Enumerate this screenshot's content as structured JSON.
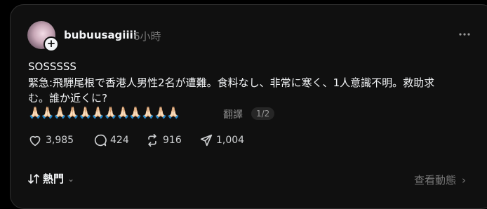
{
  "post": {
    "username": "bubuusagiiii",
    "time": "6小時",
    "lines": [
      "SOSSSSS",
      "緊急:飛騨尾根で香港人男性2名が遭難。食料なし、非常に寒く、1人意識不明。救助求",
      "む。誰か近くに?"
    ],
    "emoji_row": "🙏🏻🙏🏻🙏🏻🙏🏻🙏🏻🙏🏻🙏🏻🙏🏻🙏🏻🙏🏻🙏🏻🙏🏻",
    "translate_label": "翻譯",
    "pager": "1/2"
  },
  "actions": {
    "likes": "3,985",
    "replies": "424",
    "reposts": "916",
    "shares": "1,004"
  },
  "footer": {
    "sort_label": "熱門",
    "view_activity": "查看動態"
  },
  "icons": {
    "avatar": "avatar",
    "follow": "plus-icon",
    "more": "more-icon",
    "like": "heart-icon",
    "reply": "comment-icon",
    "repost": "repost-icon",
    "share": "send-icon",
    "sort": "sort-icon",
    "chevron": "chevron-down-icon",
    "arrow": "chevron-right-icon"
  }
}
